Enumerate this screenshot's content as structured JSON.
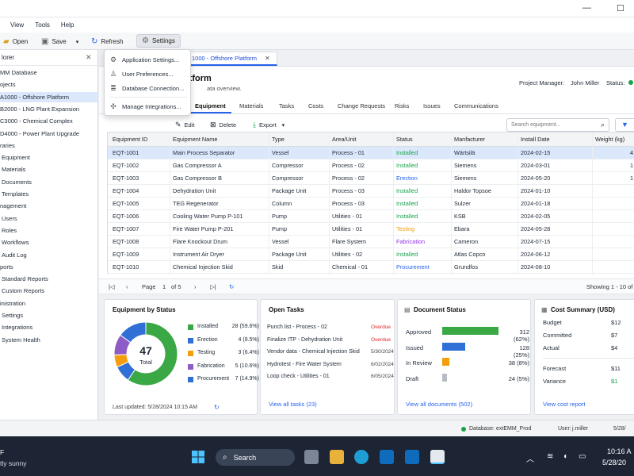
{
  "window": {
    "minimize": "—",
    "maximize": "☐"
  },
  "menu": [
    "View",
    "Tools",
    "Help"
  ],
  "toolbar": {
    "open": "Open",
    "save": "Save",
    "refresh": "Refresh",
    "settings": "Settings"
  },
  "settings_menu": [
    "Application Settings...",
    "User Preferences...",
    "Database Connection...",
    "Manage Integrations..."
  ],
  "sidebar": {
    "title": "lorer",
    "items": [
      {
        "label": "MM Database",
        "indent": 0
      },
      {
        "label": "ojects",
        "indent": 0
      },
      {
        "label": "A1000 - Offshore Platform",
        "indent": 0,
        "active": true
      },
      {
        "label": "B2000 - LNG Plant Expansion",
        "indent": 0
      },
      {
        "label": "C3000 - Chemical Complex",
        "indent": 0
      },
      {
        "label": "D4000 - Power Plant Upgrade",
        "indent": 0
      },
      {
        "label": "raries",
        "indent": 0
      },
      {
        "label": "Equipment",
        "indent": 1
      },
      {
        "label": "Materials",
        "indent": 1
      },
      {
        "label": "Documents",
        "indent": 1
      },
      {
        "label": "Templates",
        "indent": 1
      },
      {
        "label": "nagement",
        "indent": 0
      },
      {
        "label": "Users",
        "indent": 1
      },
      {
        "label": "Roles",
        "indent": 1
      },
      {
        "label": "Workflows",
        "indent": 1
      },
      {
        "label": "Audit Log",
        "indent": 1
      },
      {
        "label": "ports",
        "indent": 0
      },
      {
        "label": "Standard Reports",
        "indent": 1
      },
      {
        "label": "Custom Reports",
        "indent": 1
      },
      {
        "label": "inistration",
        "indent": 0
      },
      {
        "label": "Settings",
        "indent": 1
      },
      {
        "label": "Integrations",
        "indent": 1
      },
      {
        "label": "System Health",
        "indent": 1
      }
    ]
  },
  "doc_tab": "1000 - Offshore Platform",
  "page": {
    "title": "e Platform",
    "subtitle": "ata overview.",
    "pm_label": "Project Manager:",
    "pm_name": "John Miller",
    "status_label": "Status:"
  },
  "subtabs": [
    "",
    "Equipment",
    "Materials",
    "Tasks",
    "Costs",
    "Change Requests",
    "Risks",
    "Issues",
    "Communications"
  ],
  "actions": {
    "edit": "Edit",
    "delete": "Delete",
    "export": "Export",
    "search_placeholder": "Search equipment..."
  },
  "table": {
    "columns": [
      "Equipment ID",
      "Equipment Name",
      "Type",
      "Area/Unit",
      "Status",
      "Manfacturer",
      "Install Date",
      "Weight (kg)"
    ],
    "rows": [
      [
        "EQT-1001",
        "Main Process Separator",
        "Vessel",
        "Process - 01",
        "Installed",
        "Wärtsilä",
        "2024-02-15",
        "4"
      ],
      [
        "EQT-1002",
        "Gas Compressor A",
        "Compressor",
        "Process - 02",
        "Installed",
        "Siemens",
        "2024-03-01",
        "1"
      ],
      [
        "EQT-1003",
        "Gas Compressor B",
        "Compressor",
        "Process - 02",
        "Erection",
        "Siemens",
        "2024-05-20",
        "1"
      ],
      [
        "EQT-1004",
        "Dehydration Unit",
        "Package Unit",
        "Process - 03",
        "Installed",
        "Haldor Topsoe",
        "2024-01-10",
        ""
      ],
      [
        "EQT-1005",
        "TEG Regenerator",
        "Column",
        "Process - 03",
        "Installed",
        "Sulzer",
        "2024-01-18",
        ""
      ],
      [
        "EQT-1006",
        "Cooling Water Pump P-101",
        "Pump",
        "Utilities - 01",
        "Installed",
        "KSB",
        "2024-02-05",
        ""
      ],
      [
        "EQT-1007",
        "Fire Water Pump P-201",
        "Pump",
        "Utilities - 01",
        "Testing",
        "Ebara",
        "2024-05-28",
        ""
      ],
      [
        "EQT-1008",
        "Flare Knockout Drum",
        "Vessel",
        "Flare System",
        "Fabrication",
        "Cameron",
        "2024-07-15",
        ""
      ],
      [
        "EQT-1009",
        "Instrument Air Dryer",
        "Package Unit",
        "Utilities - 02",
        "Installed",
        "Atlas Copco",
        "2024-06-12",
        ""
      ],
      [
        "EQT-1010",
        "Chemical Injection Skid",
        "Skid",
        "Chemical - 01",
        "Procurement",
        "Grundfos",
        "2024-08-10",
        ""
      ]
    ]
  },
  "status_colors": {
    "Installed": "#16a34a",
    "Erection": "#2563eb",
    "Testing": "#f59e0b",
    "Fabrication": "#9333ea",
    "Procurement": "#2563eb"
  },
  "pager": {
    "page_label": "Page",
    "page": "1",
    "of": "of 5",
    "showing": "Showing 1 - 10 of"
  },
  "equipment_status": {
    "title": "Equipment by Status",
    "total": "47",
    "total_label": "Total",
    "items": [
      {
        "label": "Installed",
        "value": "28 (59.6%)",
        "count": 28,
        "color": "#3aa845"
      },
      {
        "label": "Erection",
        "value": "4 (8.5%)",
        "count": 4,
        "color": "#2f6fd6"
      },
      {
        "label": "Testing",
        "value": "3 (6.4%)",
        "count": 3,
        "color": "#f59e0b"
      },
      {
        "label": "Fabrication",
        "value": "5 (10.6%)",
        "count": 5,
        "color": "#8e5bc7"
      },
      {
        "label": "Procurement",
        "value": "7 (14.9%)",
        "count": 7,
        "color": "#2f6fd6"
      }
    ],
    "updated": "Last updated: 5/28/2024 10:15 AM"
  },
  "open_tasks": {
    "title": "Open Tasks",
    "items": [
      {
        "task": "Punch list - Process - 02",
        "status": "Overdue"
      },
      {
        "task": "Finalize ITP - Dehydration Unit",
        "status": "Overdue"
      },
      {
        "task": "Vendor data - Chemical Injection Skid",
        "status": "5/30/2024"
      },
      {
        "task": "Hydrotest - Fire Water System",
        "status": "6/02/2024"
      },
      {
        "task": "Loop check - Utilities - 01",
        "status": "6/05/2024"
      }
    ],
    "link": "View all tasks (23)"
  },
  "document_status": {
    "title": "Document Status",
    "items": [
      {
        "label": "Approved",
        "value": "312 (62%)",
        "pct": 62,
        "color": "#3aa845"
      },
      {
        "label": "Issued",
        "value": "128 (25%)",
        "pct": 25,
        "color": "#2f6fd6"
      },
      {
        "label": "In Review",
        "value": "38 (8%)",
        "pct": 8,
        "color": "#f59e0b"
      },
      {
        "label": "Draft",
        "value": "24 (5%)",
        "pct": 5,
        "color": "#b8bcc4"
      }
    ],
    "link": "View all documents (502)"
  },
  "cost_summary": {
    "title": "Cost Summary (USD)",
    "items": [
      {
        "label": "Budget",
        "value": "$12"
      },
      {
        "label": "Committed",
        "value": "$7"
      },
      {
        "label": "Actual",
        "value": "$4"
      },
      {
        "label": "Forecast",
        "value": "$11"
      },
      {
        "label": "Variance",
        "value": "$1"
      }
    ],
    "link": "View cost report"
  },
  "statusbar": {
    "db_label": "Database:",
    "db": "extEMM_Prod",
    "user_label": "User:",
    "user": "j.miller",
    "date": "5/28/"
  },
  "taskbar": {
    "weather_temp": "F",
    "weather": "tly sunny",
    "search": "Search",
    "time": "10:16 A",
    "date": "5/28/20"
  }
}
